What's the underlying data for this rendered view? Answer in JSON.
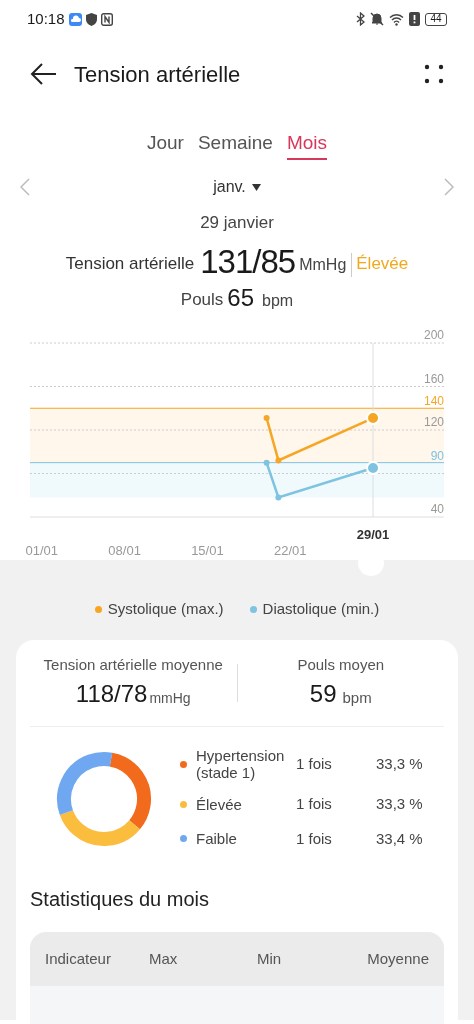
{
  "status_bar": {
    "time": "10:18",
    "battery": "44"
  },
  "header": {
    "title": "Tension artérielle"
  },
  "tabs": [
    {
      "label": "Jour",
      "selected": false
    },
    {
      "label": "Semaine",
      "selected": false
    },
    {
      "label": "Mois",
      "selected": true
    }
  ],
  "period": {
    "month": "janv.",
    "date": "29 janvier"
  },
  "reading": {
    "label": "Tension artérielle",
    "value": "131/85",
    "unit": "MmHg",
    "status": "Élevée"
  },
  "pulse": {
    "label": "Pouls",
    "value": "65",
    "unit": "bpm"
  },
  "chart_data": {
    "type": "line",
    "ylim": [
      40,
      200
    ],
    "categories": [
      "01/01",
      null,
      null,
      null,
      null,
      null,
      null,
      "08/01",
      null,
      null,
      null,
      null,
      null,
      null,
      "15/01",
      null,
      null,
      null,
      null,
      null,
      null,
      "22/01",
      null,
      null,
      null,
      null,
      null,
      null,
      "29/01",
      null,
      null
    ],
    "yticks": [
      40,
      120,
      160,
      200
    ],
    "series": [
      {
        "name": "Systolique (max.)",
        "color": "#f5a623",
        "marker": "o",
        "values": [
          null,
          null,
          null,
          null,
          null,
          null,
          null,
          null,
          null,
          null,
          null,
          null,
          null,
          null,
          null,
          null,
          null,
          null,
          null,
          131,
          92,
          null,
          null,
          null,
          null,
          null,
          null,
          null,
          131,
          null,
          null
        ]
      },
      {
        "name": "Diastolique (min.)",
        "color": "#7ec3e0",
        "marker": "o",
        "values": [
          null,
          null,
          null,
          null,
          null,
          null,
          null,
          null,
          null,
          null,
          null,
          null,
          null,
          null,
          null,
          null,
          null,
          null,
          null,
          90,
          58,
          null,
          null,
          null,
          null,
          null,
          null,
          null,
          85,
          null,
          null
        ]
      }
    ],
    "ref_lines": [
      {
        "axis": "y",
        "value": 140,
        "label": "140",
        "color": "#f5a623"
      },
      {
        "axis": "y",
        "value": 90,
        "label": "90",
        "color": "#7ec3e0"
      }
    ],
    "bands": [
      {
        "axis": "y",
        "from": 90,
        "to": 140,
        "color": "#fff6ec"
      },
      {
        "axis": "y",
        "from": 58,
        "to": 90,
        "color": "#f0f9fc"
      }
    ]
  },
  "summary": {
    "avg_bp": {
      "label": "Tension artérielle moyenne",
      "value": "118/78",
      "unit": "mmHg"
    },
    "avg_pulse": {
      "label": "Pouls moyen",
      "value": "59",
      "unit": "bpm"
    }
  },
  "distribution": [
    {
      "label": "Hypertension (stade 1)",
      "count": "1 fois",
      "percent": "33,3 %",
      "color": "#f26b1d"
    },
    {
      "label": "Élevée",
      "count": "1 fois",
      "percent": "33,3 %",
      "color": "#fbbd3d"
    },
    {
      "label": "Faible",
      "count": "1 fois",
      "percent": "33,4 %",
      "color": "#6fa8f0"
    }
  ],
  "stats": {
    "title": "Statistiques du mois",
    "columns": [
      "Indicateur",
      "Max",
      "Min",
      "Moyenne"
    ]
  }
}
